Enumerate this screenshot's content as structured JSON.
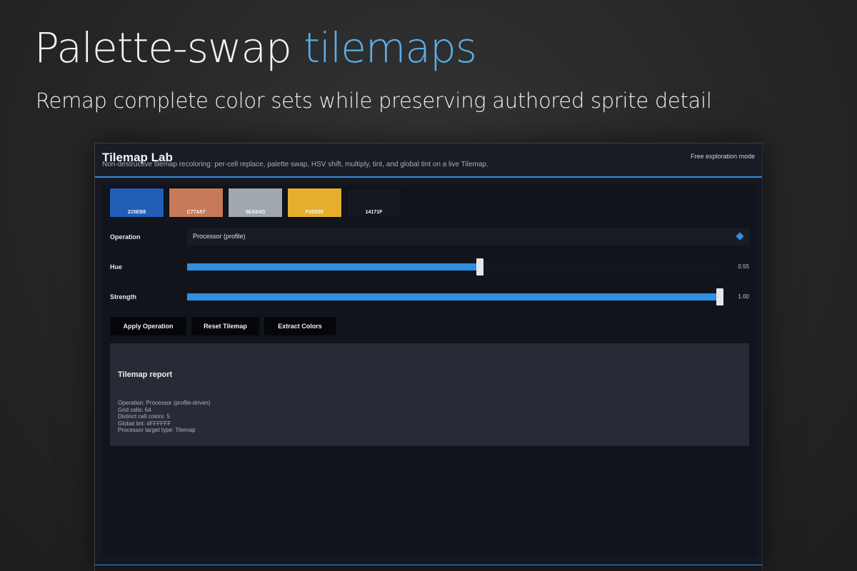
{
  "hero": {
    "title_main": "Palette-swap ",
    "title_accent": "tilemaps",
    "subtitle": "Remap complete color sets while preserving authored sprite detail"
  },
  "window": {
    "title": "Tilemap Lab",
    "description": "Non-destructive tilemap recoloring: per-cell replace, palette swap, HSV shift, multiply, tint, and global tint on a live Tilemap.",
    "mode": "Free exploration mode"
  },
  "swatches": [
    {
      "label": "215EB8",
      "color": "#215EB8"
    },
    {
      "label": "C77A57",
      "color": "#C77A57"
    },
    {
      "label": "9EA8AD",
      "color": "#9EA8AD"
    },
    {
      "label": "F2B82E",
      "color": "#E6AE2C"
    },
    {
      "label": "14171F",
      "color": "#14171F"
    }
  ],
  "operation": {
    "label": "Operation",
    "value": "Processor (profile)"
  },
  "hue": {
    "label": "Hue",
    "value": 0.55,
    "value_text": "0.55"
  },
  "strength": {
    "label": "Strength",
    "value": 1.0,
    "value_text": "1.00"
  },
  "buttons": {
    "apply": "Apply Operation",
    "reset": "Reset Tilemap",
    "extract": "Extract Colors"
  },
  "report": {
    "title": "Tilemap report",
    "lines": [
      "Operation: Processor (profile-driven)",
      "Grid cells: 64",
      "Distinct cell colors: 5",
      "Global tint: #FFFFFF",
      "Processor target type: Tilemap"
    ]
  },
  "colors": {
    "accent": "#2f8fe0",
    "hero_accent": "#5aaee8"
  }
}
